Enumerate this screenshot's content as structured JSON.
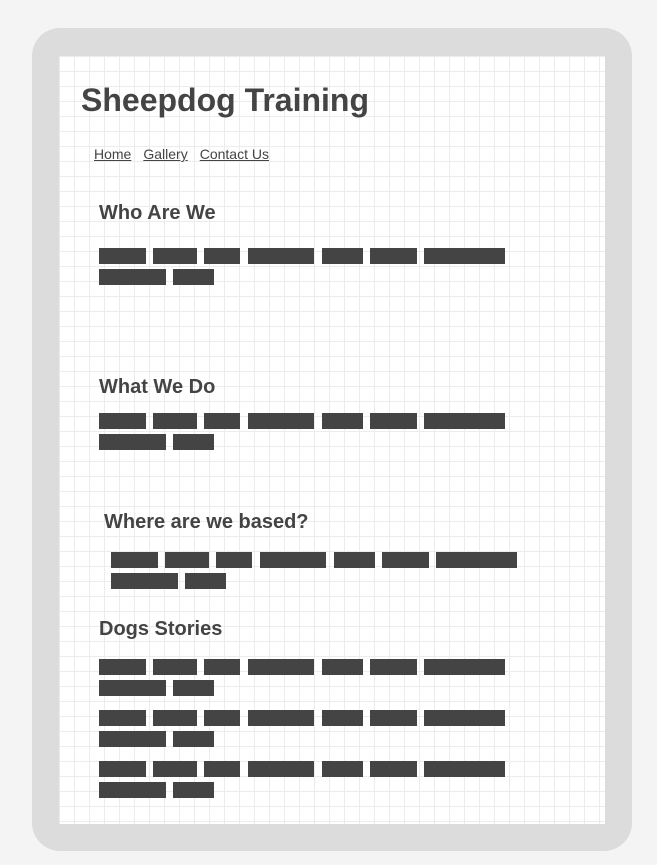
{
  "site": {
    "title": "Sheepdog Training"
  },
  "nav": {
    "items": [
      {
        "label": "Home"
      },
      {
        "label": "Gallery"
      },
      {
        "label": "Contact Us"
      }
    ]
  },
  "sections": [
    {
      "title": "Who Are We"
    },
    {
      "title": "What We Do"
    },
    {
      "title": "Where are we based?"
    },
    {
      "title": "Dogs Stories"
    }
  ],
  "colors": {
    "text": "#444444",
    "placeholder_bar": "#444444",
    "frame": "#dcdcdc",
    "grid_line": "#ececec",
    "page_bg": "#f4f4f4"
  }
}
